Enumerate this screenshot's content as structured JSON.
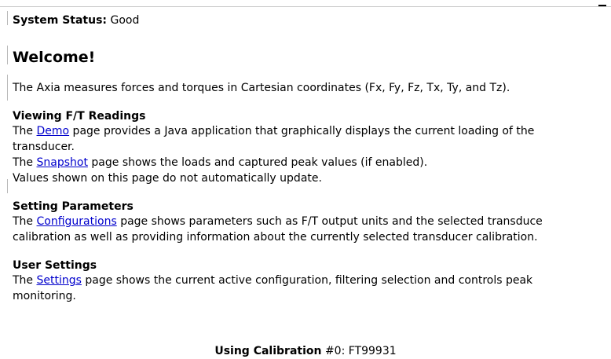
{
  "status": {
    "label": "System Status:",
    "value": "Good"
  },
  "welcome": {
    "title": "Welcome!",
    "intro": "The Axia measures forces and torques in Cartesian coordinates (Fx, Fy, Fz, Tx, Ty, and Tz)."
  },
  "sections": {
    "viewing": {
      "heading": "Viewing F/T Readings",
      "demo_prefix": "The ",
      "demo_link": "Demo",
      "demo_line1": " page provides a Java application that graphically displays the current loading of the",
      "demo_line2": "transducer.",
      "snapshot_prefix": "The ",
      "snapshot_link": "Snapshot",
      "snapshot_text": " page shows the loads and captured peak values (if enabled).",
      "update_note": "Values shown on this page do not automatically update."
    },
    "parameters": {
      "heading": "Setting Parameters",
      "prefix": "The ",
      "link": "Configurations",
      "line1": " page shows parameters such as F/T output units and the selected transduce",
      "line2": "calibration as well as providing information about the currently selected transducer calibration."
    },
    "user_settings": {
      "heading": "User Settings",
      "prefix": "The ",
      "link": "Settings",
      "line1": " page shows the current active configuration, filtering selection and controls peak",
      "line2": "monitoring."
    }
  },
  "calibration": {
    "label": "Using Calibration",
    "value": "#0: FT99931"
  }
}
